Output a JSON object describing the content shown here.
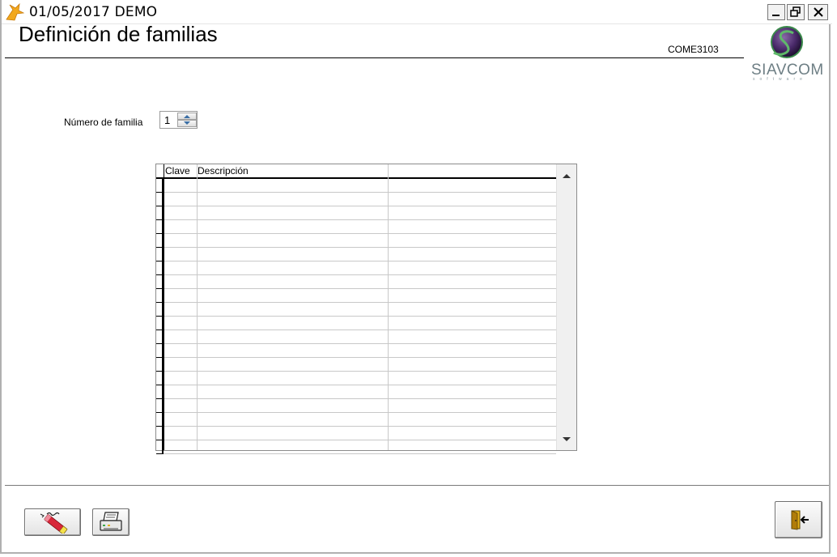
{
  "window": {
    "title": "01/05/2017  DEMO",
    "icons": {
      "app": "app-phoenix-icon",
      "minimize": "minimize-icon",
      "restore": "restore-icon",
      "close": "close-icon"
    }
  },
  "header": {
    "title": "Definición de familias",
    "screen_code": "COME3103",
    "logo_text": "SIAVCOM",
    "logo_sub": "software"
  },
  "form": {
    "family_number_label": "Número de familia",
    "family_number_value": "1"
  },
  "grid": {
    "columns": [
      "Clave",
      "Descripción",
      ""
    ],
    "rows": [
      [
        "",
        "",
        ""
      ],
      [
        "",
        "",
        ""
      ],
      [
        "",
        "",
        ""
      ],
      [
        "",
        "",
        ""
      ],
      [
        "",
        "",
        ""
      ],
      [
        "",
        "",
        ""
      ],
      [
        "",
        "",
        ""
      ],
      [
        "",
        "",
        ""
      ],
      [
        "",
        "",
        ""
      ],
      [
        "",
        "",
        ""
      ],
      [
        "",
        "",
        ""
      ],
      [
        "",
        "",
        ""
      ],
      [
        "",
        "",
        ""
      ],
      [
        "",
        "",
        ""
      ],
      [
        "",
        "",
        ""
      ],
      [
        "",
        "",
        ""
      ],
      [
        "",
        "",
        ""
      ],
      [
        "",
        "",
        ""
      ],
      [
        "",
        "",
        ""
      ],
      [
        "",
        "",
        ""
      ]
    ]
  },
  "toolbar": {
    "edit_icon": "eraser-pencil-icon",
    "print_icon": "printer-icon",
    "exit_icon": "exit-door-icon"
  },
  "colors": {
    "logo_green": "#3a8a4a",
    "logo_purple": "#4a2a6a",
    "logo_text": "#6d7e84"
  }
}
